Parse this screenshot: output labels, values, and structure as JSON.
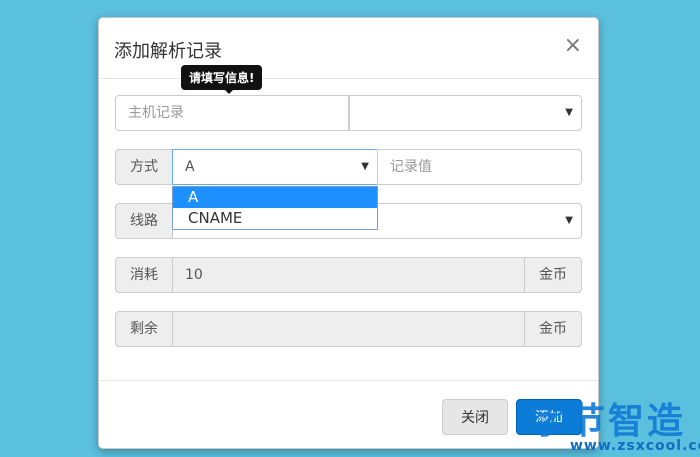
{
  "modal": {
    "title": "添加解析记录",
    "close_symbol": "×"
  },
  "tooltip": {
    "text": "请填写信息!"
  },
  "row1": {
    "host_placeholder": "主机记录",
    "domain_value": ""
  },
  "row2": {
    "label": "方式",
    "selected": "A",
    "value_placeholder": "记录值"
  },
  "dropdown": {
    "options": [
      "A",
      "CNAME"
    ],
    "selected_index": 0
  },
  "row3": {
    "label": "线路",
    "selected": ""
  },
  "row4": {
    "label": "消耗",
    "value": "10",
    "unit": "金币"
  },
  "row5": {
    "label": "剩余",
    "value": "",
    "unit": "金币"
  },
  "footer": {
    "close_label": "关闭",
    "add_label": "添加"
  },
  "watermark": {
    "title": "字节智造",
    "url": "www.zsxcool.com"
  },
  "colors": {
    "background": "#5bc0de",
    "primary": "#0a7cd8",
    "selected_option": "#1e90ff"
  }
}
